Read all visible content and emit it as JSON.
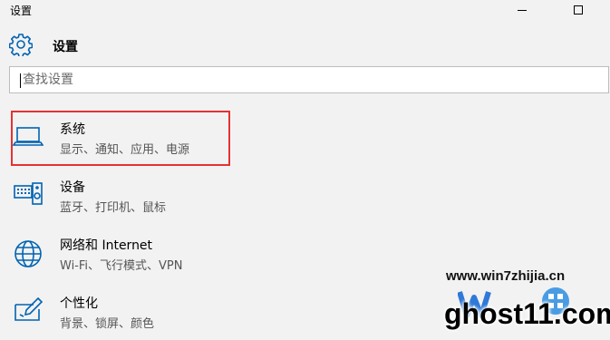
{
  "window": {
    "title": "设置"
  },
  "header": {
    "title": "设置",
    "icon": "gear-icon"
  },
  "search": {
    "placeholder": "查找设置",
    "value": ""
  },
  "categories": [
    {
      "title": "系统",
      "subtitle": "显示、通知、应用、电源",
      "icon": "laptop-icon",
      "highlighted": true
    },
    {
      "title": "设备",
      "subtitle": "蓝牙、打印机、鼠标",
      "icon": "devices-icon",
      "highlighted": false
    },
    {
      "title": "网络和 Internet",
      "subtitle": "Wi-Fi、飞行模式、VPN",
      "icon": "globe-icon",
      "highlighted": false
    },
    {
      "title": "个性化",
      "subtitle": "背景、锁屏、颜色",
      "icon": "personalization-icon",
      "highlighted": false
    }
  ],
  "colors": {
    "accent": "#0063b1",
    "highlight": "#e53232",
    "background": "#f2f2f2"
  },
  "watermark": {
    "site": "www.win7zhijia.cn",
    "ghost": "ghost11.com"
  }
}
